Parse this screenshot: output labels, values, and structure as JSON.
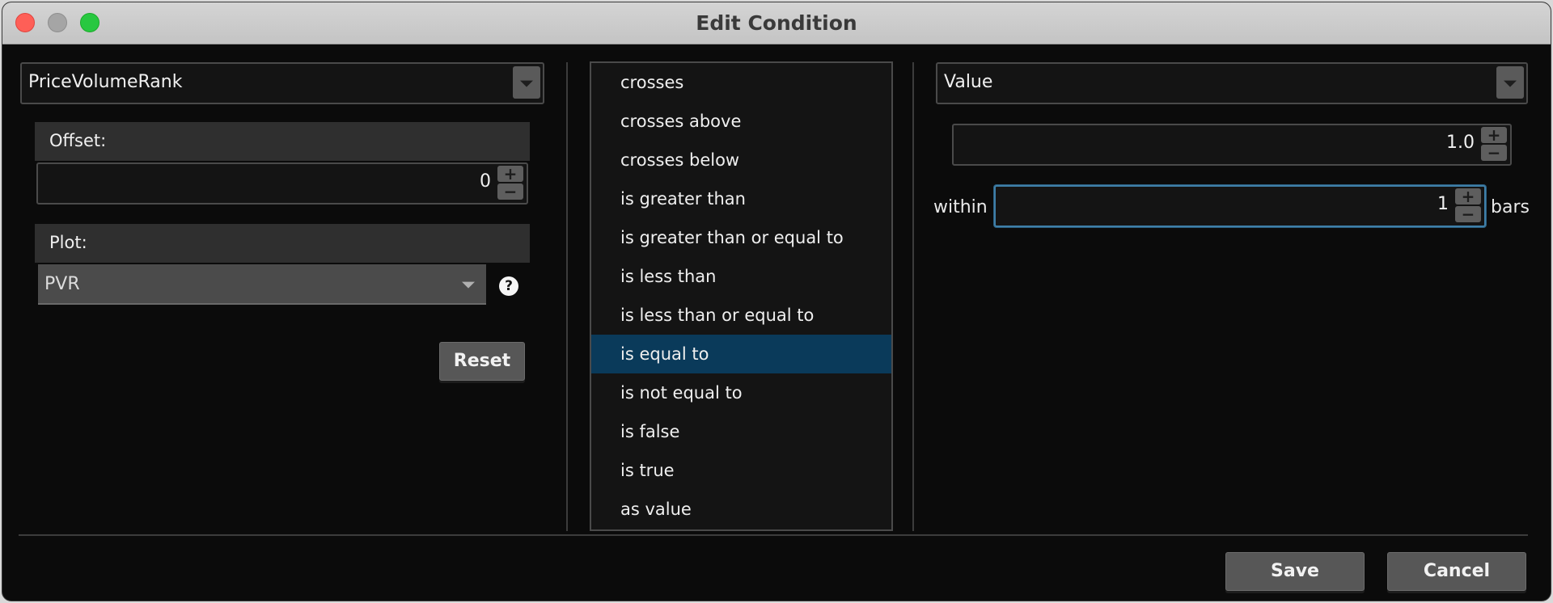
{
  "window": {
    "title": "Edit Condition"
  },
  "left_panel": {
    "study_dropdown": {
      "value": "PriceVolumeRank"
    },
    "offset": {
      "label": "Offset:",
      "value": "0"
    },
    "plot": {
      "label": "Plot:",
      "value": "PVR"
    },
    "reset_label": "Reset"
  },
  "operators": {
    "items": [
      "crosses",
      "crosses above",
      "crosses below",
      "is greater than",
      "is greater than or equal to",
      "is less than",
      "is less than or equal to",
      "is equal to",
      "is not equal to",
      "is false",
      "is true",
      "as value"
    ],
    "selected": "is equal to"
  },
  "right_panel": {
    "type_dropdown": {
      "value": "Value"
    },
    "value_field": {
      "value": "1.0"
    },
    "within_label": "within",
    "within_field": {
      "value": "1"
    },
    "bars_label": "bars"
  },
  "footer": {
    "save_label": "Save",
    "cancel_label": "Cancel"
  },
  "icons": {
    "close": "close-button-red",
    "minimize": "minimize-button-gray",
    "zoom": "zoom-button-green",
    "help": "question-mark-icon",
    "plus": "plus-icon",
    "minus": "minus-icon",
    "dropdown": "triangle-down-icon"
  },
  "colors": {
    "selection": "#0a3a5a",
    "focus_border": "#3f7fa8",
    "background": "#0b0b0b"
  }
}
